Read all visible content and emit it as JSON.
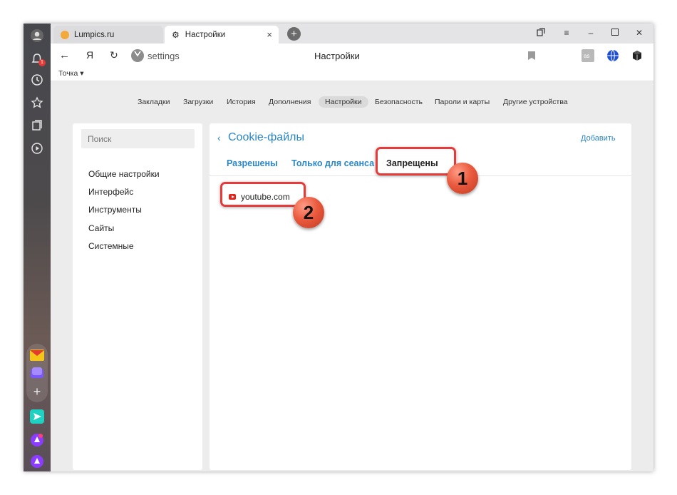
{
  "tabs": [
    {
      "label": "Lumpics.ru",
      "active": false
    },
    {
      "label": "Настройки",
      "active": true
    }
  ],
  "tabbar": {
    "close_icon": "×",
    "new_tab_icon": "+"
  },
  "addressbar": {
    "back_icon": "←",
    "yandex_icon": "Я",
    "reload_icon": "↻",
    "url": "settings",
    "page_title": "Настройки",
    "bookmarks_bar_folder": "Точка ▾"
  },
  "sidebar": {
    "notification_count": "1"
  },
  "top_nav": {
    "items": [
      "Закладки",
      "Загрузки",
      "История",
      "Дополнения",
      "Настройки",
      "Безопасность",
      "Пароли и карты",
      "Другие устройства"
    ],
    "active": "Настройки"
  },
  "left_panel": {
    "search_placeholder": "Поиск",
    "menu": [
      "Общие настройки",
      "Интерфейс",
      "Инструменты",
      "Сайты",
      "Системные"
    ]
  },
  "main_panel": {
    "title": "Cookie-файлы",
    "back_icon": "‹",
    "add_label": "Добавить",
    "subtabs": [
      "Разрешены",
      "Только для сеанса",
      "Запрещены"
    ],
    "active_subtab": "Запрещены",
    "sites": [
      "youtube.com"
    ]
  },
  "annotations": {
    "badge1": "1",
    "badge2": "2"
  },
  "colors": {
    "accent": "#2a87c7",
    "highlight": "#e53b3b",
    "badge": "#ea5a3e"
  }
}
